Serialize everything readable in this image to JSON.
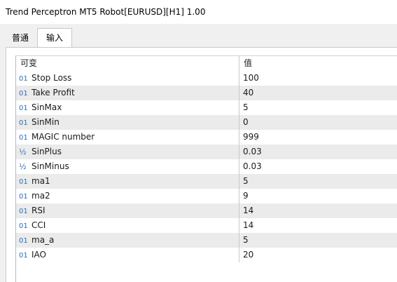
{
  "window": {
    "title": "Trend Perceptron MT5 Robot[EURUSD][H1] 1.00"
  },
  "tabs": [
    {
      "label": "普通"
    },
    {
      "label": "输入"
    }
  ],
  "grid": {
    "headers": {
      "variable": "可变",
      "value": "值"
    },
    "rows": [
      {
        "type_icon": "01",
        "name": "Stop Loss",
        "value": "100"
      },
      {
        "type_icon": "01",
        "name": "Take Profit",
        "value": "40"
      },
      {
        "type_icon": "01",
        "name": "SinMax",
        "value": "5"
      },
      {
        "type_icon": "01",
        "name": "SinMin",
        "value": "0"
      },
      {
        "type_icon": "01",
        "name": "MAGIC number",
        "value": "999"
      },
      {
        "type_icon": "½",
        "name": "SinPlus",
        "value": "0.03"
      },
      {
        "type_icon": "½",
        "name": "SinMinus",
        "value": "0.03"
      },
      {
        "type_icon": "01",
        "name": "ma1",
        "value": "5"
      },
      {
        "type_icon": "01",
        "name": "ma2",
        "value": "9"
      },
      {
        "type_icon": "01",
        "name": "RSI",
        "value": "14"
      },
      {
        "type_icon": "01",
        "name": "CCI",
        "value": "14"
      },
      {
        "type_icon": "01",
        "name": "ma_a",
        "value": "5"
      },
      {
        "type_icon": "01",
        "name": "IAO",
        "value": "20"
      }
    ]
  }
}
